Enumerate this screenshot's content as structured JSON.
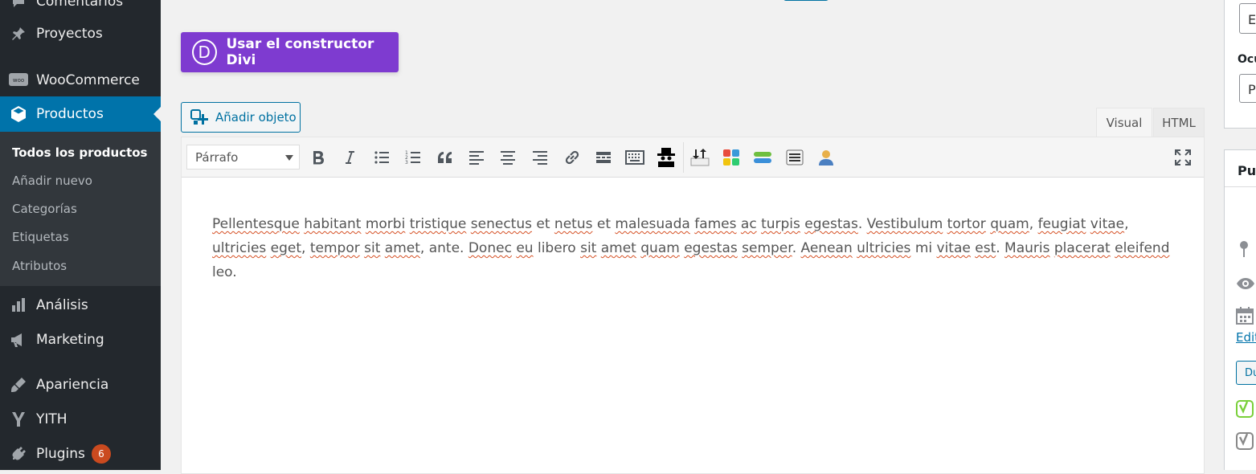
{
  "sidebar": {
    "items": [
      {
        "label": "Comentarios",
        "icon": "comments-icon"
      },
      {
        "label": "Proyectos",
        "icon": "pin-icon"
      },
      {
        "label": "WooCommerce",
        "icon": "woo-icon"
      },
      {
        "label": "Productos",
        "icon": "box-icon",
        "active": true
      },
      {
        "label": "Análisis",
        "icon": "chart-icon"
      },
      {
        "label": "Marketing",
        "icon": "megaphone-icon"
      },
      {
        "label": "Apariencia",
        "icon": "brush-icon"
      },
      {
        "label": "YITH",
        "icon": "yith-icon"
      },
      {
        "label": "Plugins",
        "icon": "plugin-icon",
        "badge": "6"
      }
    ],
    "submenu": [
      "Todos los productos",
      "Añadir nuevo",
      "Categorías",
      "Etiquetas",
      "Atributos"
    ]
  },
  "divi": {
    "label": "Usar el constructor Divi",
    "letter": "D"
  },
  "media": {
    "label": "Añadir objeto"
  },
  "tabs": {
    "visual": "Visual",
    "html": "HTML"
  },
  "toolbar": {
    "format": "Párrafo"
  },
  "content": {
    "w1": "Pellentesque",
    "w2": "habitant",
    "w3": "morbi",
    "w4": "tristique",
    "w5": "senectus",
    "t1": "et",
    "w6": "netus",
    "t2": "et",
    "w7": "malesuada",
    "w8": "fames",
    "w9": "ac",
    "w10": "turpis",
    "w11": "egestas",
    "t3": ".",
    "w12": "Vestibulum",
    "w13": "tortor",
    "w14": "quam",
    "t4": ",",
    "w15": "feugiat",
    "w16": "vitae",
    "t5": ",",
    "w17": "ultricies",
    "w18": "eget",
    "t6": ",",
    "w19": "tempor",
    "w20": "sit",
    "w21": "amet",
    "t7": ", ante.",
    "w22": "Donec",
    "w23": "eu",
    "t8": "libero",
    "w24": "sit",
    "w25": "amet",
    "w26": "quam",
    "w27": "egestas",
    "w28": "semper",
    "t9": ".",
    "w29": "Aenean",
    "w30": "ultricies",
    "t10": "mi",
    "w31": "vitae",
    "w32": "est",
    "t11": ".",
    "w33": "Mauris",
    "w34": "placerat",
    "w35": "eleifend",
    "t12": "leo."
  },
  "right": {
    "input1_char": "E",
    "label_partial": "Ocu",
    "input2_char": "P",
    "heading_partial": "Pul",
    "edit_link": "Edit",
    "button_partial": "Du"
  },
  "colors": {
    "sidebar_bg": "#23282d",
    "active": "#0073aa",
    "divi": "#7e3bd0",
    "badge": "#ca4a1f"
  }
}
